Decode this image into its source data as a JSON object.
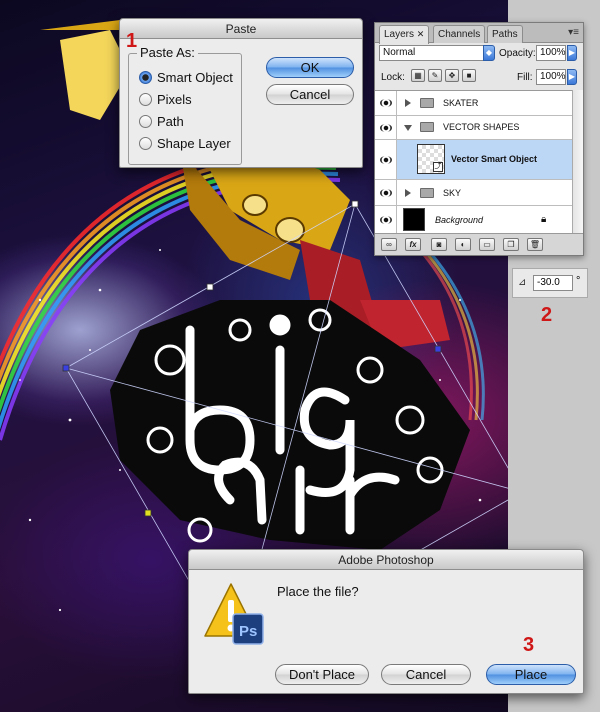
{
  "paste_dialog": {
    "title": "Paste",
    "group_label": "Paste As:",
    "options": [
      {
        "label": "Smart Object",
        "selected": true
      },
      {
        "label": "Pixels",
        "selected": false
      },
      {
        "label": "Path",
        "selected": false
      },
      {
        "label": "Shape Layer",
        "selected": false
      }
    ],
    "ok_label": "OK",
    "cancel_label": "Cancel"
  },
  "layers_panel": {
    "tabs": [
      "Layers",
      "Channels",
      "Paths"
    ],
    "blend_mode": "Normal",
    "opacity_label": "Opacity:",
    "opacity_value": "100%",
    "lock_label": "Lock:",
    "fill_label": "Fill:",
    "fill_value": "100%",
    "layers": [
      {
        "name": "SKATER",
        "kind": "group",
        "expanded": false
      },
      {
        "name": "VECTOR SHAPES",
        "kind": "group",
        "expanded": true
      },
      {
        "name": "Vector Smart Object",
        "kind": "smart-object",
        "selected": true
      },
      {
        "name": "SKY",
        "kind": "group",
        "expanded": false
      },
      {
        "name": "Background",
        "kind": "background",
        "locked": true
      }
    ],
    "footer_icons": [
      "link-icon",
      "fx-icon",
      "mask-icon",
      "adjustment-icon",
      "folder-icon",
      "new-layer-icon",
      "trash-icon"
    ]
  },
  "angle_field": {
    "value": "-30.0",
    "unit": "°"
  },
  "ps_dialog": {
    "title": "Adobe Photoshop",
    "message": "Place the file?",
    "dont_place_label": "Don't Place",
    "cancel_label": "Cancel",
    "place_label": "Place"
  },
  "steps": [
    "1",
    "2",
    "3"
  ],
  "colors": {
    "step_red": "#cf1717",
    "selected_layer": "#bcd6f6",
    "aqua_blue": "#4f8fe0"
  }
}
